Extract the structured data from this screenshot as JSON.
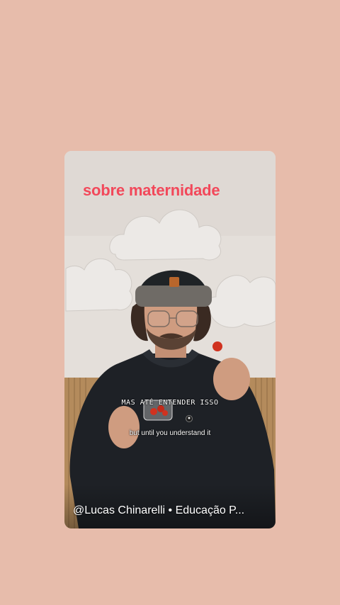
{
  "video": {
    "overlay_title": "sobre maternidade",
    "caption_main": "MAS ATÉ ENTENDER ISSO",
    "caption_sub": "but until you understand it",
    "channel_handle": "@Lucas Chinarelli • Educação P..."
  },
  "colors": {
    "page_background": "#e7bcab",
    "overlay_title": "#f2485a",
    "caption_text": "#ffffff"
  }
}
